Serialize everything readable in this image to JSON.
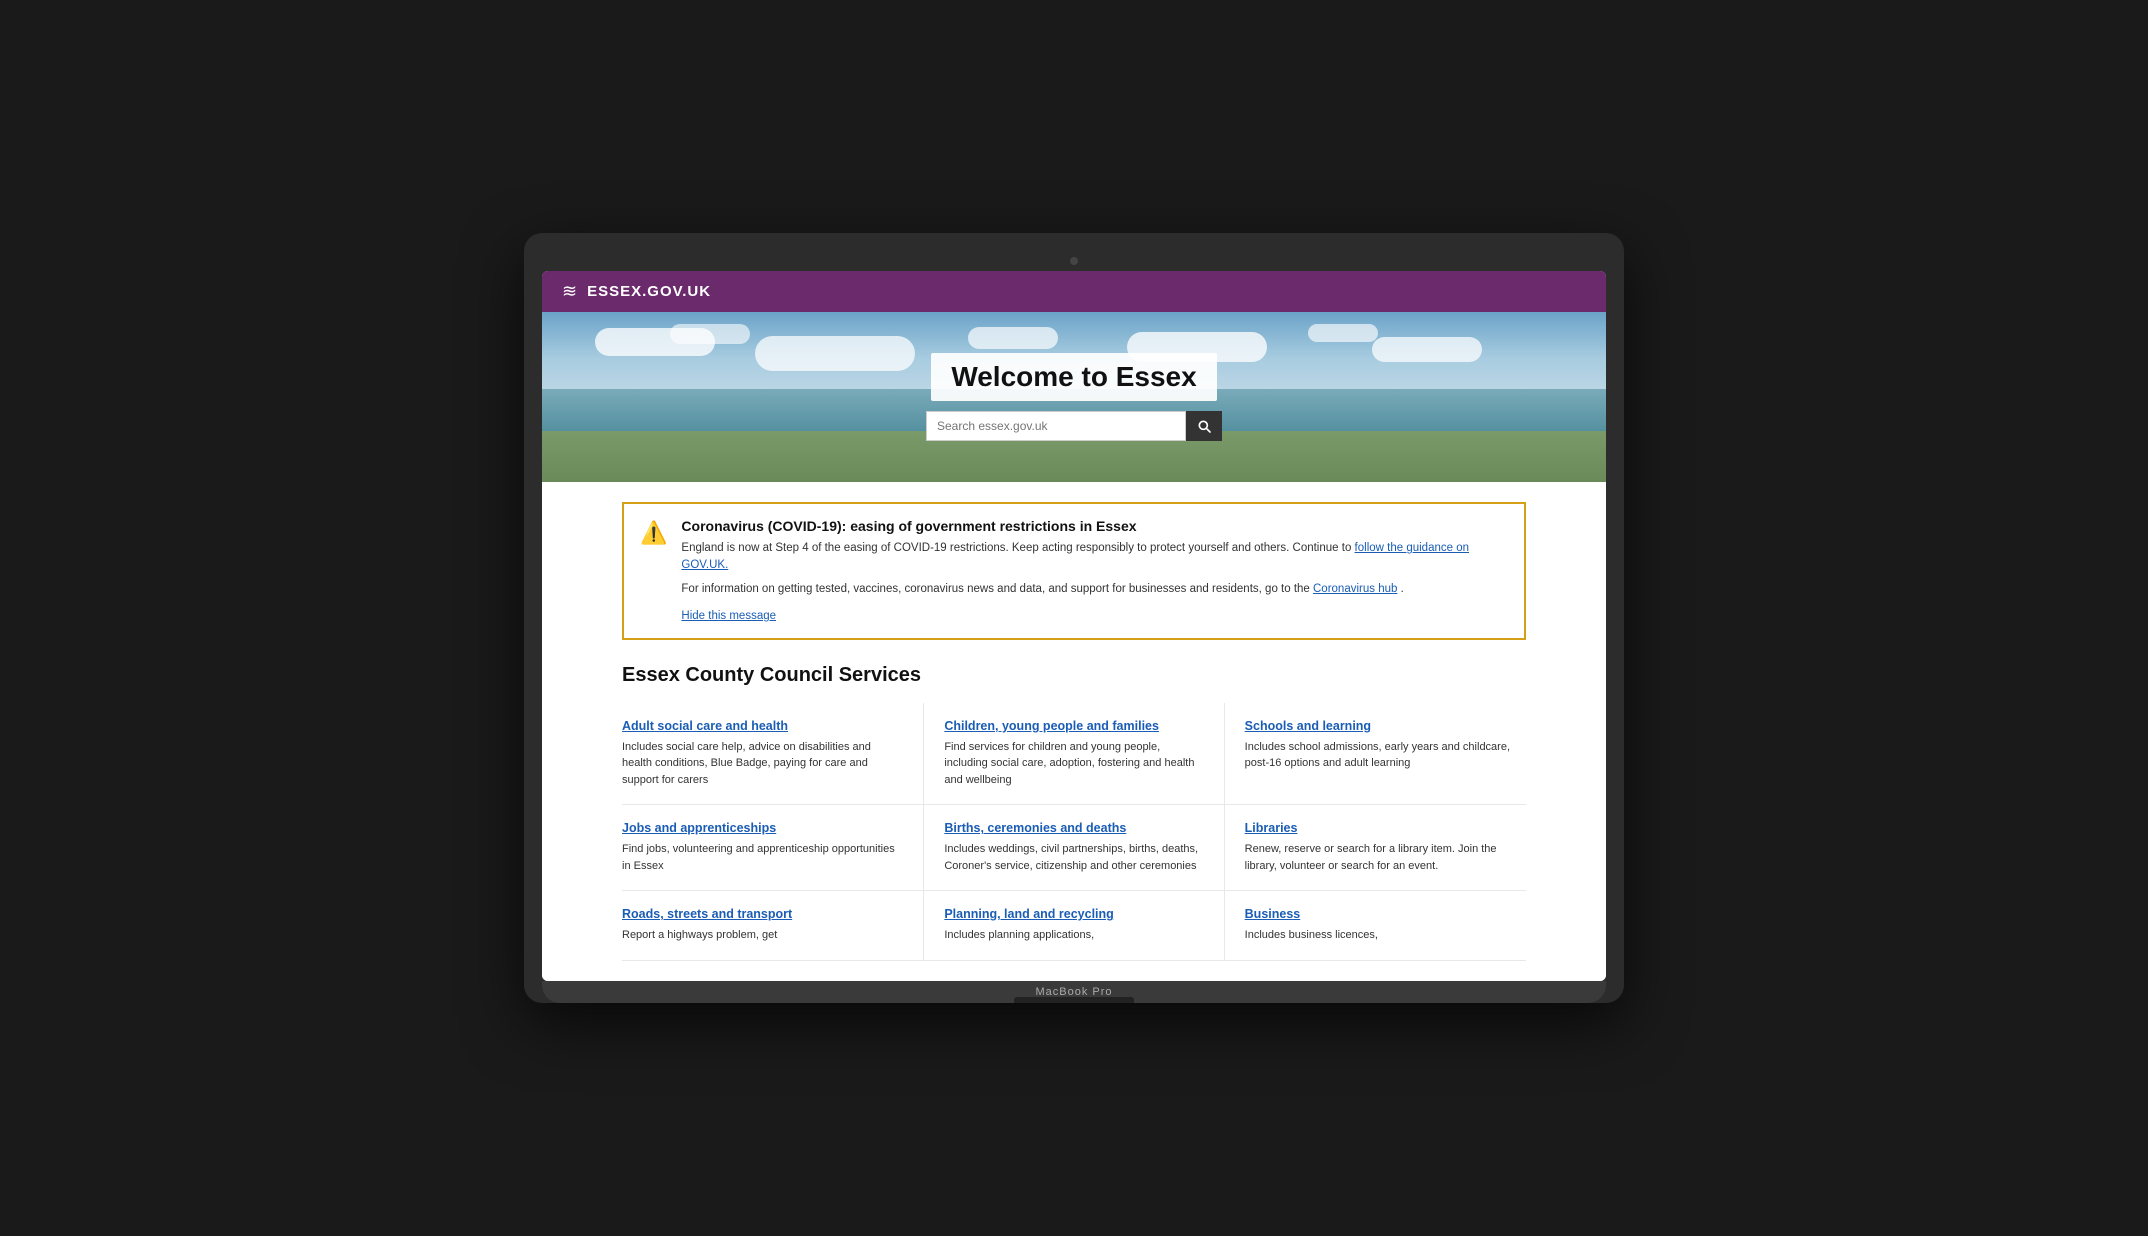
{
  "laptop": {
    "model": "MacBook Pro"
  },
  "header": {
    "logo_icon": "≋",
    "logo_text": "ESSEX.GOV.UK"
  },
  "hero": {
    "title": "Welcome to Essex",
    "search_placeholder": "Search essex.gov.uk"
  },
  "alert": {
    "title": "Coronavirus (COVID-19): easing of government restrictions in Essex",
    "text1": "England is now at Step 4 of the easing of COVID-19 restrictions. Keep acting responsibly to protect yourself and others. Continue to ",
    "link1_text": "follow the guidance on GOV.UK.",
    "link1_href": "#",
    "text2": "For information on getting tested, vaccines, coronavirus news and data, and support for businesses and residents, go to the ",
    "link2_text": "Coronavirus hub",
    "link2_href": "#",
    "text2_end": " .",
    "hide_label": "Hide this message"
  },
  "services": {
    "heading": "Essex County Council Services",
    "items": [
      {
        "title": "Adult social care and health",
        "desc": "Includes social care help, advice on disabilities and health conditions, Blue Badge, paying for care and support for carers",
        "href": "#"
      },
      {
        "title": "Children, young people and families",
        "desc": "Find services for children and young people, including social care, adoption, fostering and health and wellbeing",
        "href": "#"
      },
      {
        "title": "Schools and learning",
        "desc": "Includes school admissions, early years and childcare, post-16 options and adult learning",
        "href": "#"
      },
      {
        "title": "Jobs and apprenticeships",
        "desc": "Find jobs, volunteering and apprenticeship opportunities in Essex",
        "href": "#"
      },
      {
        "title": "Births, ceremonies and deaths",
        "desc": "Includes weddings, civil partnerships, births, deaths, Coroner's service, citizenship and other ceremonies",
        "href": "#"
      },
      {
        "title": "Libraries",
        "desc": "Renew, reserve or search for a library item. Join the library, volunteer or search for an event.",
        "href": "#"
      },
      {
        "title": "Roads, streets and transport",
        "desc": "Report a highways problem, get",
        "href": "#"
      },
      {
        "title": "Planning, land and recycling",
        "desc": "Includes planning applications,",
        "href": "#"
      },
      {
        "title": "Business",
        "desc": "Includes business licences,",
        "href": "#"
      }
    ]
  }
}
